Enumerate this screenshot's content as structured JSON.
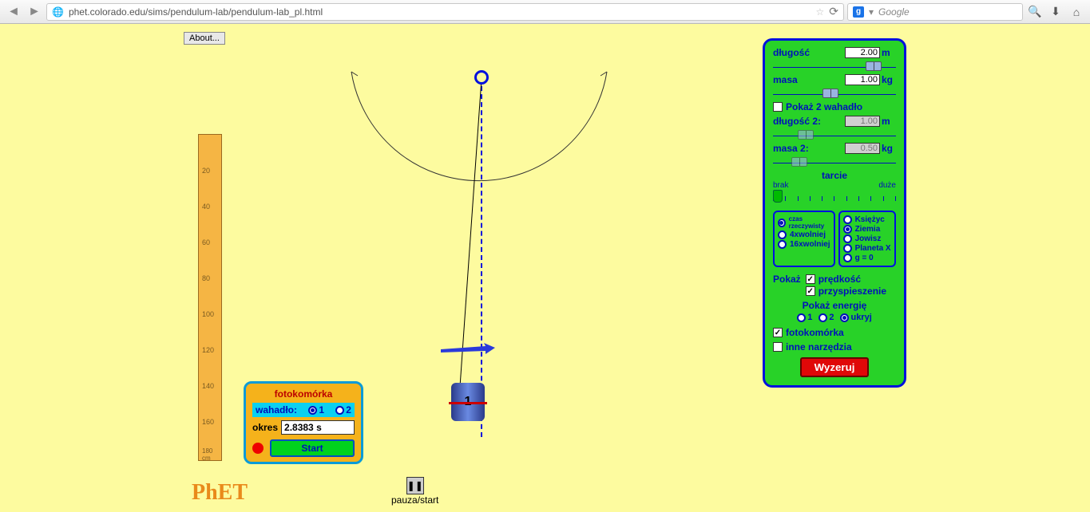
{
  "browser": {
    "url": "phet.colorado.edu/sims/pendulum-lab/pendulum-lab_pl.html",
    "search_placeholder": "Google"
  },
  "about_label": "About...",
  "phet_label": "PhET",
  "pause_label": "pauza/start",
  "bob_label": "1",
  "ruler_marks": [
    "20",
    "40",
    "60",
    "80",
    "100",
    "120",
    "140",
    "160",
    "180 cm"
  ],
  "photogate": {
    "title": "fotokomórka",
    "row_label": "wahadło:",
    "opt1": "1",
    "opt2": "2",
    "okres_label": "okres",
    "okres_value": "2.8383 s",
    "start_label": "Start"
  },
  "panel": {
    "length_label": "długość",
    "length_value": "2.00",
    "length_unit": "m",
    "mass_label": "masa",
    "mass_value": "1.00",
    "mass_unit": "kg",
    "show2_label": "Pokaż 2 wahadło",
    "length2_label": "długość 2:",
    "length2_value": "1.00",
    "mass2_label": "masa 2:",
    "mass2_value": "0.50",
    "friction_label": "tarcie",
    "friction_min": "brak",
    "friction_max": "duże",
    "speed_opts": [
      "czas rzeczywisty",
      "4xwolniej",
      "16xwolniej"
    ],
    "speed_selected": 0,
    "body_opts": [
      "Księżyc",
      "Ziemia",
      "Jowisz",
      "Planeta X",
      "g = 0"
    ],
    "body_selected": 1,
    "show_label": "Pokaż",
    "velocity_label": "prędkość",
    "accel_label": "przyspieszenie",
    "energy_label": "Pokaż energię",
    "energy_opts": [
      "1",
      "2",
      "ukryj"
    ],
    "energy_selected": 2,
    "photogate_check": "fotokomórka",
    "other_tools": "inne narzędzia",
    "reset_label": "Wyzeruj"
  }
}
